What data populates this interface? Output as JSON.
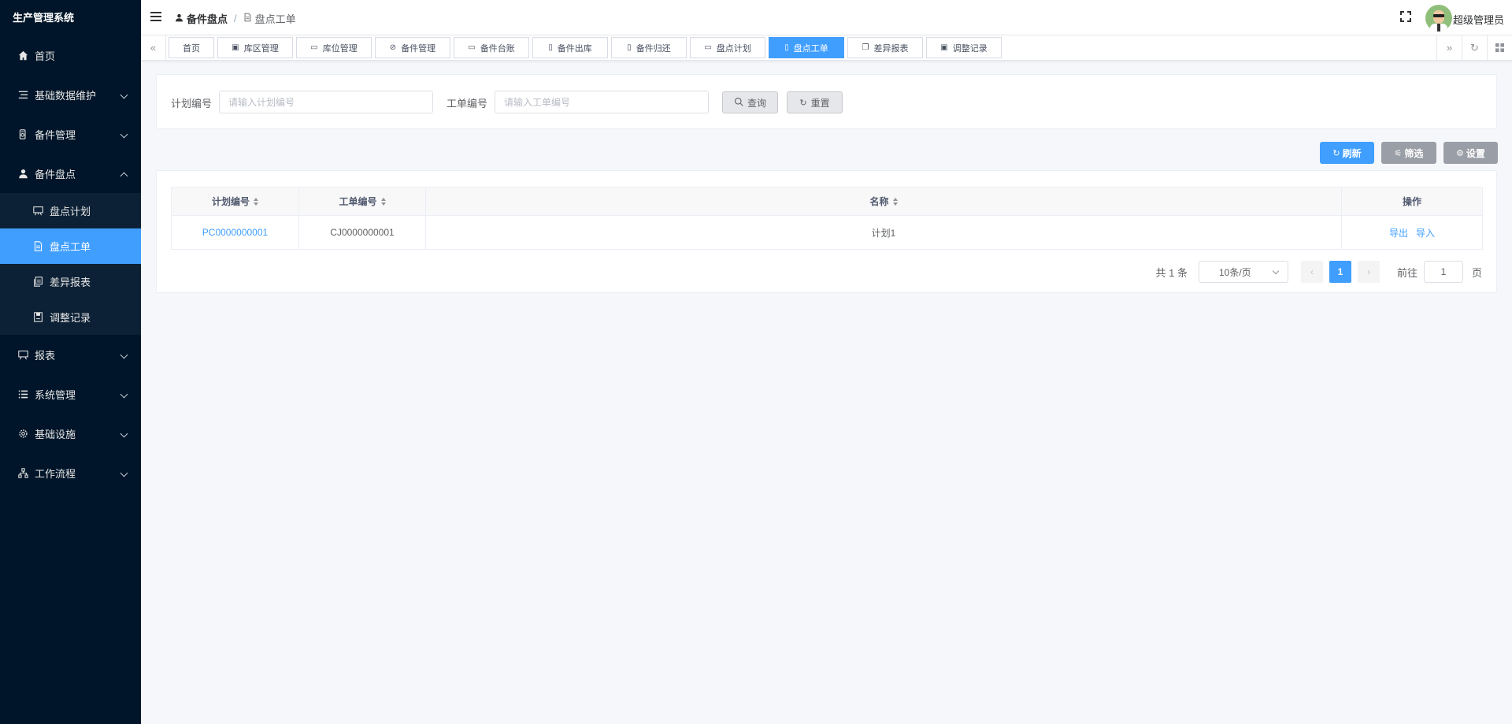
{
  "app": {
    "title": "生产管理系统"
  },
  "sidebar": {
    "items": [
      {
        "label": "首页",
        "icon": "home-icon"
      },
      {
        "label": "基础数据维护",
        "icon": "list-icon"
      },
      {
        "label": "备件管理",
        "icon": "parts-icon"
      },
      {
        "label": "备件盘点",
        "icon": "user-icon",
        "expanded": true,
        "children": [
          {
            "label": "盘点计划",
            "icon": "plan-icon"
          },
          {
            "label": "盘点工单",
            "icon": "document-icon",
            "active": true
          },
          {
            "label": "差异报表",
            "icon": "copy-icon"
          },
          {
            "label": "调整记录",
            "icon": "save-icon"
          }
        ]
      },
      {
        "label": "报表",
        "icon": "chart-icon"
      },
      {
        "label": "系统管理",
        "icon": "menu-list-icon"
      },
      {
        "label": "基础设施",
        "icon": "gear-icon"
      },
      {
        "label": "工作流程",
        "icon": "flow-icon"
      }
    ]
  },
  "header": {
    "breadcrumb": [
      {
        "label": "备件盘点",
        "icon": "user-icon"
      },
      {
        "label": "盘点工单",
        "icon": "document-icon"
      }
    ],
    "separator": "/",
    "user": "超级管理员"
  },
  "tags": [
    {
      "label": "首页",
      "icon": ""
    },
    {
      "label": "库区管理",
      "icon": "box-icon"
    },
    {
      "label": "库位管理",
      "icon": "shelf-icon"
    },
    {
      "label": "备件管理",
      "icon": "parts-icon"
    },
    {
      "label": "备件台账",
      "icon": "ledger-icon"
    },
    {
      "label": "备件出库",
      "icon": "document-icon"
    },
    {
      "label": "备件归还",
      "icon": "document-icon"
    },
    {
      "label": "盘点计划",
      "icon": "plan-icon"
    },
    {
      "label": "盘点工单",
      "icon": "document-icon",
      "active": true
    },
    {
      "label": "差异报表",
      "icon": "copy-icon"
    },
    {
      "label": "调整记录",
      "icon": "save-icon"
    }
  ],
  "search": {
    "plan_label": "计划编号",
    "plan_placeholder": "请输入计划编号",
    "plan_value": "",
    "order_label": "工单编号",
    "order_placeholder": "请输入工单编号",
    "order_value": "",
    "query_label": "查询",
    "reset_label": "重置"
  },
  "toolbar": {
    "refresh_label": "刷新",
    "filter_label": "筛选",
    "settings_label": "设置",
    "colors": {
      "refresh": "#409eff",
      "filter": "#9a9ea6",
      "settings": "#9a9ea6"
    }
  },
  "table": {
    "columns": [
      "计划编号",
      "工单编号",
      "名称",
      "操作"
    ],
    "rows": [
      {
        "plan_no": "PC0000000001",
        "order_no": "CJ0000000001",
        "name": "计划1",
        "actions": [
          "导出",
          "导入"
        ]
      }
    ]
  },
  "pagination": {
    "total": "共 1 条",
    "page_size": "10条/页",
    "current_page": "1",
    "goto_label": "前往",
    "goto_value": "1",
    "goto_unit": "页"
  }
}
